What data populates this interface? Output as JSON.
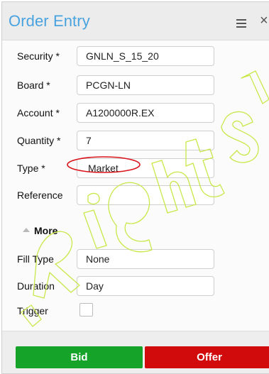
{
  "window": {
    "title": "Order Entry",
    "menu_icon": "hamburger-menu-icon",
    "close_icon": "close-icon",
    "close_glyph": "×"
  },
  "fields": {
    "security": {
      "label": "Security *",
      "value": "GNLN_S_15_20"
    },
    "board": {
      "label": "Board *",
      "value": "PCGN-LN"
    },
    "account": {
      "label": "Account *",
      "value": "A1200000R.EX"
    },
    "quantity": {
      "label": "Quantity *",
      "value": "7"
    },
    "type": {
      "label": "Type *",
      "value": "Market"
    },
    "reference": {
      "label": "Reference",
      "value": ""
    }
  },
  "more_section": {
    "label": "More",
    "toggle_icon": "triangle-up-icon"
  },
  "extra_fields": {
    "fill_type": {
      "label": "Fill Type",
      "value": "None"
    },
    "duration": {
      "label": "Duration",
      "value": "Day"
    },
    "trigger": {
      "label": "Trigger",
      "checked": false
    }
  },
  "actions": {
    "bid_label": "Bid",
    "offer_label": "Offer"
  },
  "colors": {
    "title": "#4aa3df",
    "bid": "#16a32a",
    "offer": "#d10b0b",
    "annotation": "#d9141b",
    "watermark": "#c8e84a"
  }
}
